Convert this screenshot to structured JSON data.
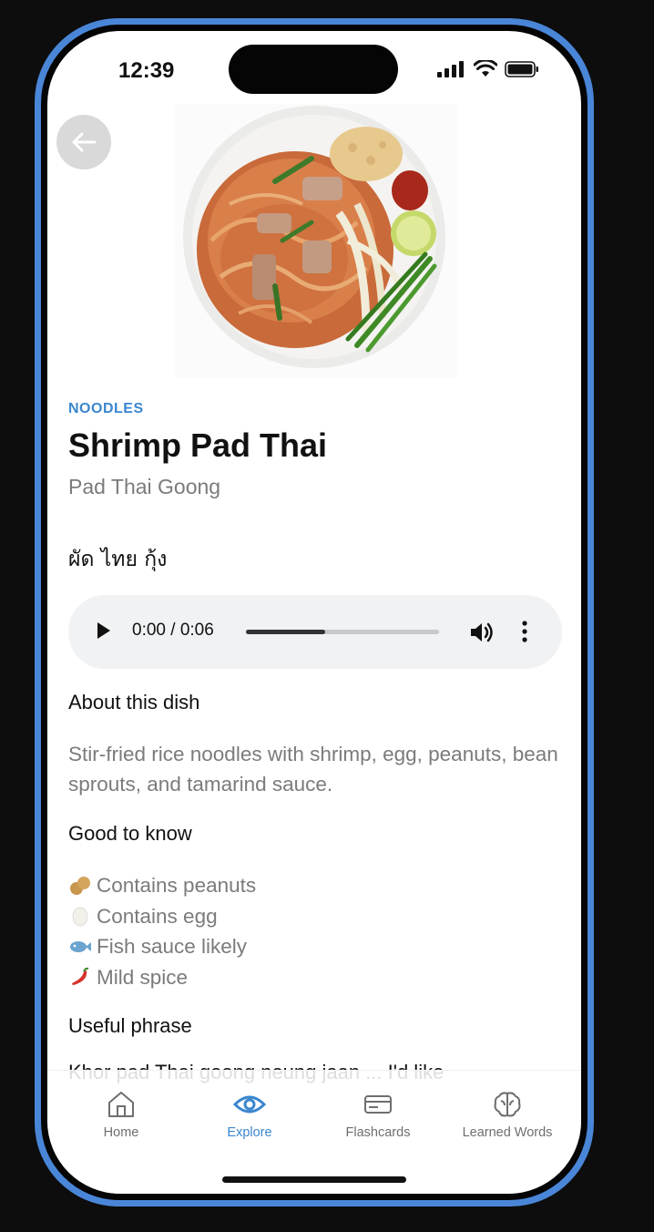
{
  "status_bar": {
    "time": "12:39"
  },
  "dish": {
    "category": "NOODLES",
    "title": "Shrimp Pad Thai",
    "romanized": "Pad Thai Goong",
    "thai": "ผัด ไทย กุ้ง",
    "image_icon": "pad-thai-photo"
  },
  "audio": {
    "time": "0:00 / 0:06",
    "progress_fraction": 0.41
  },
  "about": {
    "heading": "About this dish",
    "text": "Stir-fried rice noodles with shrimp, egg, peanuts, bean sprouts, and tamarind sauce."
  },
  "good_to_know": {
    "heading": "Good to know",
    "items": [
      {
        "icon": "peanut-icon",
        "label": "Contains peanuts"
      },
      {
        "icon": "egg-icon",
        "label": "Contains egg"
      },
      {
        "icon": "fish-icon",
        "label": "Fish sauce likely"
      },
      {
        "icon": "chili-icon",
        "label": "Mild spice"
      }
    ]
  },
  "phrase": {
    "heading": "Useful phrase",
    "text": "Khor pad Thai goong neung jaan ... I'd like"
  },
  "tabs": [
    {
      "label": "Home",
      "icon": "home-icon",
      "active": false
    },
    {
      "label": "Explore",
      "icon": "eye-icon",
      "active": true
    },
    {
      "label": "Flashcards",
      "icon": "card-icon",
      "active": false
    },
    {
      "label": "Learned Words",
      "icon": "brain-icon",
      "active": false
    }
  ],
  "colors": {
    "accent": "#3a86cf",
    "frame": "#4a86d8",
    "muted_text": "#7b7b7b"
  }
}
